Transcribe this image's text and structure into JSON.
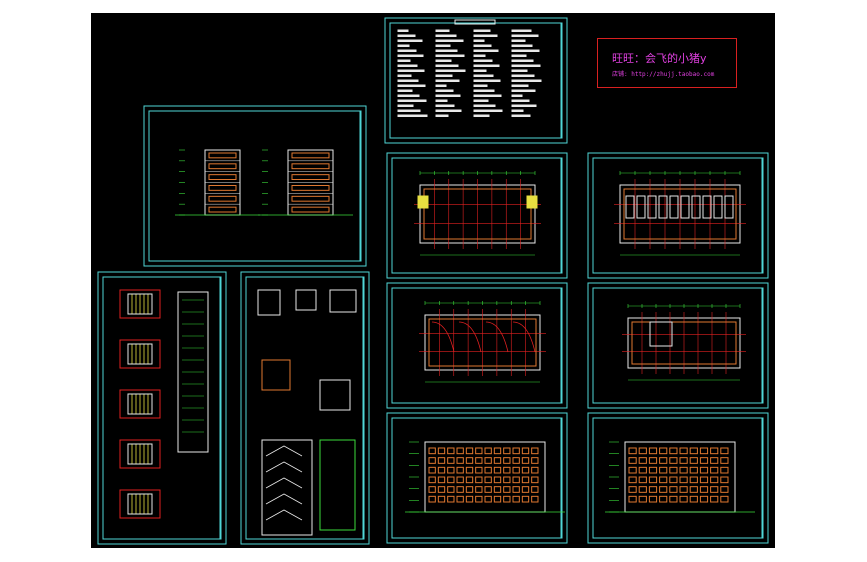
{
  "viewport": {
    "background": "#000000",
    "frame_color": "#4fd6d6"
  },
  "watermark": {
    "line1": "旺旺：会飞的小猪y",
    "line2": "店铺: http://zhujj.taobao.com",
    "color": "#e040e0",
    "border_color": "#d82020"
  },
  "drawing_colors": {
    "cyan": "#4fd6d6",
    "green": "#3bdc3b",
    "red": "#e02020",
    "white": "#e8e8e8",
    "yellow": "#e8e040",
    "orange": "#e07830",
    "magenta": "#e040e0"
  }
}
